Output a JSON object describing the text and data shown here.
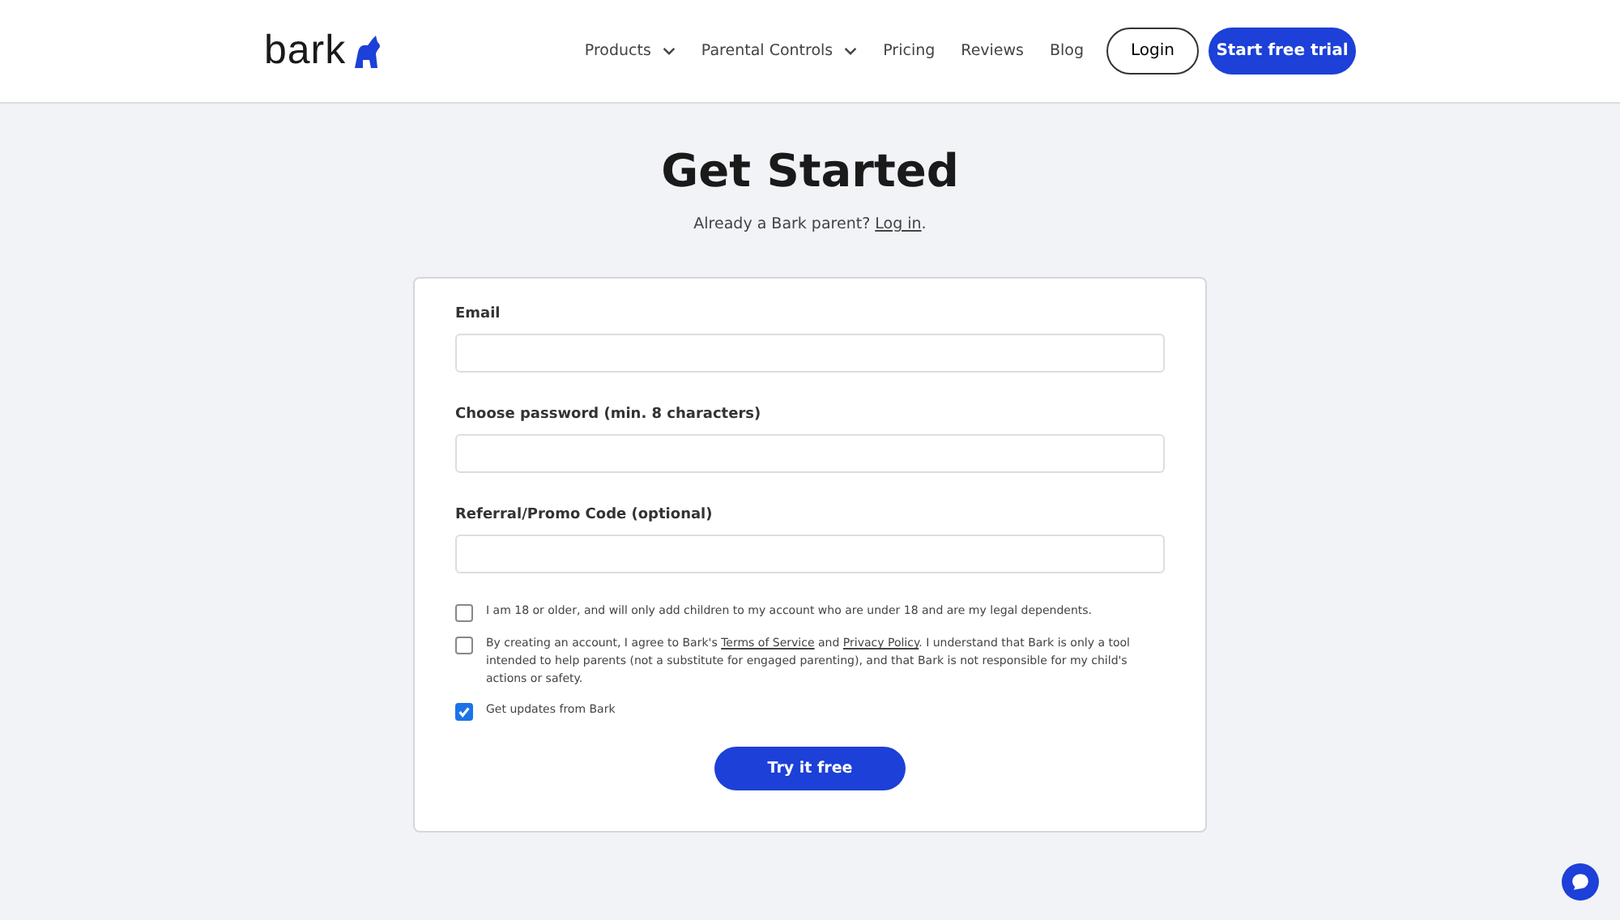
{
  "header": {
    "logo": "bark",
    "nav": [
      {
        "label": "Products",
        "dropdown": true
      },
      {
        "label": "Parental Controls",
        "dropdown": true
      },
      {
        "label": "Pricing",
        "dropdown": false
      },
      {
        "label": "Reviews",
        "dropdown": false
      },
      {
        "label": "Blog",
        "dropdown": false
      }
    ],
    "login": "Login",
    "cta": "Start free trial"
  },
  "title": "Get Started",
  "subtitle": {
    "text": "Already a Bark parent?",
    "link": "Log in",
    "after": "."
  },
  "fields": [
    {
      "label": "Email"
    },
    {
      "label": "Choose password (min. 8 characters)"
    },
    {
      "label": "Referral/Promo Code (optional)"
    }
  ],
  "checks": [
    {
      "checked": false,
      "parts": [
        {
          "kind": "text",
          "text": "I am 18 or older, and will only add children to my account who are under 18 and are my legal dependents."
        }
      ]
    },
    {
      "checked": false,
      "parts": [
        {
          "kind": "text",
          "text": "By creating an account, I agree to Bark's "
        },
        {
          "kind": "link",
          "text": "Terms of Service"
        },
        {
          "kind": "text",
          "text": " and "
        },
        {
          "kind": "link",
          "text": "Privacy Policy"
        },
        {
          "kind": "text",
          "text": ". I understand that Bark is only a tool intended to help parents (not a substitute for engaged parenting), and that Bark is not responsible for my child's actions or safety."
        }
      ]
    },
    {
      "checked": true,
      "parts": [
        {
          "kind": "text",
          "text": "Get updates from Bark"
        }
      ]
    }
  ],
  "submit": "Try it free"
}
